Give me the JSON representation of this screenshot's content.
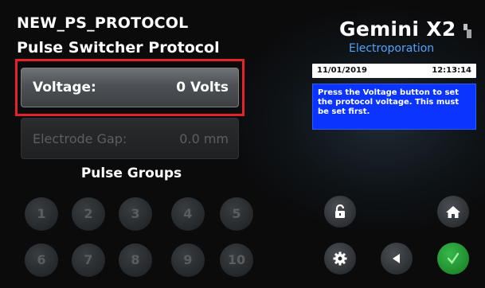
{
  "header": {
    "protocol_name": "NEW_PS_PROTOCOL",
    "protocol_type": "Pulse Switcher Protocol",
    "brand": "Gemini X2",
    "brand_sub": "Electroporation"
  },
  "voltage": {
    "label": "Voltage:",
    "value": "0 Volts"
  },
  "electrode_gap": {
    "label": "Electrode Gap:",
    "value": "0.0 mm"
  },
  "pulse_groups": {
    "title": "Pulse Groups",
    "buttons": [
      "1",
      "2",
      "3",
      "4",
      "5",
      "6",
      "7",
      "8",
      "9",
      "10"
    ]
  },
  "status": {
    "date": "11/01/2019",
    "time": "12:13:14"
  },
  "help_text": "Press the Voltage button to set the protocol voltage. This must be set first.",
  "icons": {
    "unlock": "unlock-icon",
    "home": "home-icon",
    "settings": "gear-icon",
    "back": "back-arrow-icon",
    "confirm": "checkmark-icon",
    "usb": "usb-icon"
  },
  "colors": {
    "highlight": "#e3222a",
    "help_bg": "#0b35ff",
    "confirm": "#1f8c2d",
    "brand_sub": "#4fa3ff"
  }
}
